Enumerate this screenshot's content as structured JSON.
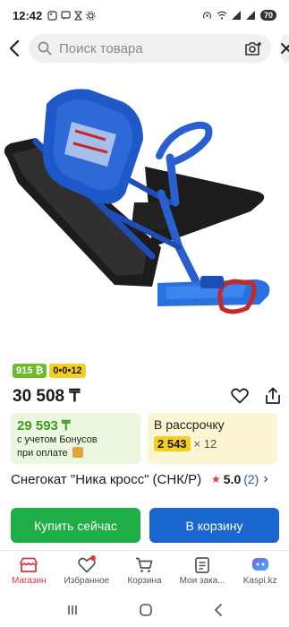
{
  "status_bar": {
    "time": "12:42",
    "left_icons": [
      "gallery-icon",
      "chat-icon",
      "hourglass-icon",
      "settings-icon"
    ],
    "right_icons": [
      "hotspot-icon",
      "wifi-icon",
      "signal-icon",
      "signal-icon"
    ],
    "battery": "70"
  },
  "search": {
    "placeholder": "Поиск товара"
  },
  "badges": {
    "green": "915 ₿",
    "yellow": "0•0•12"
  },
  "price": {
    "main": "30 508 ₸"
  },
  "bonus_card": {
    "price": "29 593 ₸",
    "line1": "с учетом Бонусов",
    "line2": "при оплате"
  },
  "install_card": {
    "title": "В рассрочку",
    "amount": "2 543",
    "multiplier": "× 12"
  },
  "product": {
    "title": "Снегокат \"Ника кросс\" (СНК/Р)",
    "rating": "5.0",
    "reviews": "(2)"
  },
  "buttons": {
    "buy": "Купить сейчас",
    "cart": "В корзину"
  },
  "bottom_nav": [
    {
      "label": "Магазин",
      "icon": "shop-icon",
      "active": true
    },
    {
      "label": "Избранное",
      "icon": "heart-icon",
      "active": false
    },
    {
      "label": "Корзина",
      "icon": "cart-icon",
      "active": false
    },
    {
      "label": "Мои зака...",
      "icon": "orders-icon",
      "active": false
    },
    {
      "label": "Kaspi.kz",
      "icon": "assistant-icon",
      "active": false
    }
  ],
  "colors": {
    "accent_red": "#d63b43",
    "buy_green": "#1eae45",
    "cart_blue": "#1a66cf",
    "bonus_green": "#3f9a1f",
    "installment_yellow": "#f4cf21"
  }
}
